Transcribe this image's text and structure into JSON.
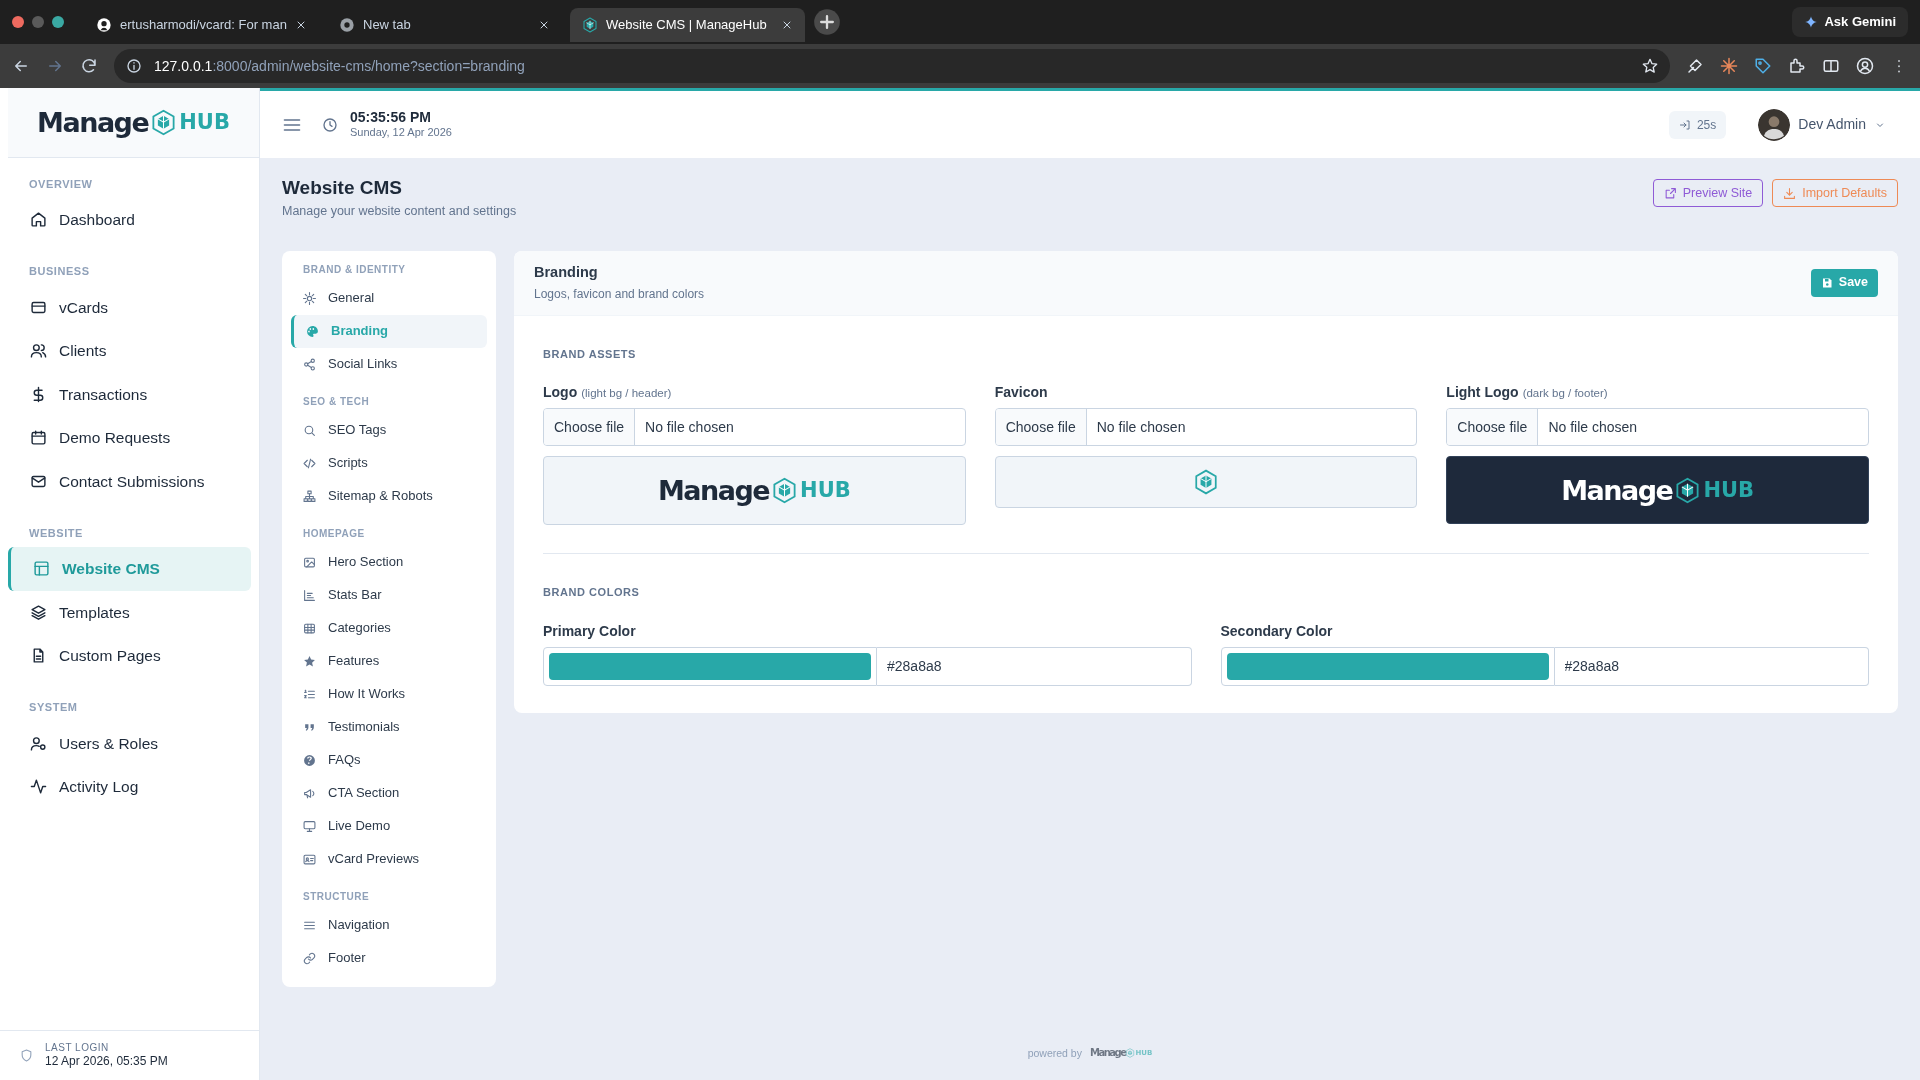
{
  "browser": {
    "tabs": [
      {
        "title": "ertusharmodi/vcard: For man",
        "selected": false,
        "kind": "github"
      },
      {
        "title": "New tab",
        "selected": false,
        "kind": "chrome"
      },
      {
        "title": "Website CMS | ManageHub",
        "selected": true,
        "kind": "app"
      }
    ],
    "address": {
      "host": "127.0.0.1",
      "path": ":8000/admin/website-cms/home?section=branding"
    },
    "assistant_button": "Ask Gemini"
  },
  "sidebar": {
    "logo": {
      "word": "Manage",
      "accent": "HUB"
    },
    "sections": [
      {
        "title": "OVERVIEW",
        "items": [
          {
            "label": "Dashboard",
            "selected": false
          }
        ]
      },
      {
        "title": "BUSINESS",
        "items": [
          {
            "label": "vCards",
            "selected": false
          },
          {
            "label": "Clients",
            "selected": false
          },
          {
            "label": "Transactions",
            "selected": false
          },
          {
            "label": "Demo Requests",
            "selected": false
          },
          {
            "label": "Contact Submissions",
            "selected": false
          }
        ]
      },
      {
        "title": "WEBSITE",
        "items": [
          {
            "label": "Website CMS",
            "selected": true
          },
          {
            "label": "Templates",
            "selected": false
          },
          {
            "label": "Custom Pages",
            "selected": false
          }
        ]
      },
      {
        "title": "SYSTEM",
        "items": [
          {
            "label": "Users & Roles",
            "selected": false
          },
          {
            "label": "Activity Log",
            "selected": false
          }
        ]
      }
    ],
    "last_login": {
      "label": "LAST LOGIN",
      "value": "12 Apr 2026, 05:35 PM"
    }
  },
  "header": {
    "time": "05:35:56 PM",
    "date": "Sunday, 12 Apr 2026",
    "session": "25s",
    "user": "Dev Admin"
  },
  "page": {
    "title": "Website CMS",
    "subtitle": "Manage your website content and settings",
    "actions": [
      {
        "label": "Preview Site",
        "kind": "preview"
      },
      {
        "label": "Import Defaults",
        "kind": "import"
      }
    ]
  },
  "cms_nav": {
    "sections": [
      {
        "title": "BRAND & IDENTITY",
        "items": [
          {
            "label": "General",
            "selected": false
          },
          {
            "label": "Branding",
            "selected": true
          },
          {
            "label": "Social Links",
            "selected": false
          }
        ]
      },
      {
        "title": "SEO & TECH",
        "items": [
          {
            "label": "SEO Tags",
            "selected": false
          },
          {
            "label": "Scripts",
            "selected": false
          },
          {
            "label": "Sitemap & Robots",
            "selected": false
          }
        ]
      },
      {
        "title": "HOMEPAGE",
        "items": [
          {
            "label": "Hero Section",
            "selected": false
          },
          {
            "label": "Stats Bar",
            "selected": false
          },
          {
            "label": "Categories",
            "selected": false
          },
          {
            "label": "Features",
            "selected": false
          },
          {
            "label": "How It Works",
            "selected": false
          },
          {
            "label": "Testimonials",
            "selected": false
          },
          {
            "label": "FAQs",
            "selected": false
          },
          {
            "label": "CTA Section",
            "selected": false
          },
          {
            "label": "Live Demo",
            "selected": false
          },
          {
            "label": "vCard Previews",
            "selected": false
          }
        ]
      },
      {
        "title": "STRUCTURE",
        "items": [
          {
            "label": "Navigation",
            "selected": false
          },
          {
            "label": "Footer",
            "selected": false
          }
        ]
      }
    ]
  },
  "panel": {
    "title": "Branding",
    "subtitle": "Logos, favicon and brand colors",
    "save": "Save",
    "assets": {
      "heading": "BRAND ASSETS",
      "fields": [
        {
          "label": "Logo",
          "hint": "(light bg / header)",
          "button": "Choose file",
          "status": "No file chosen",
          "kind": "logo",
          "preview": {
            "word": "Manage",
            "accent": "HUB"
          }
        },
        {
          "label": "Favicon",
          "button": "Choose file",
          "status": "No file chosen",
          "kind": "favicon"
        },
        {
          "label": "Light Logo",
          "hint": "(dark bg / footer)",
          "button": "Choose file",
          "status": "No file chosen",
          "kind": "light_logo",
          "preview": {
            "word": "Manage",
            "accent": "HUB"
          }
        }
      ]
    },
    "colors": {
      "heading": "BRAND COLORS",
      "fields": [
        {
          "label": "Primary Color",
          "color": "#28a8a8",
          "value": "#28a8a8"
        },
        {
          "label": "Secondary Color",
          "color": "#28a8a8",
          "value": "#28a8a8"
        }
      ]
    }
  },
  "footer": {
    "text": "powered by",
    "logo": {
      "word": "Manage",
      "accent": "HUB"
    }
  }
}
